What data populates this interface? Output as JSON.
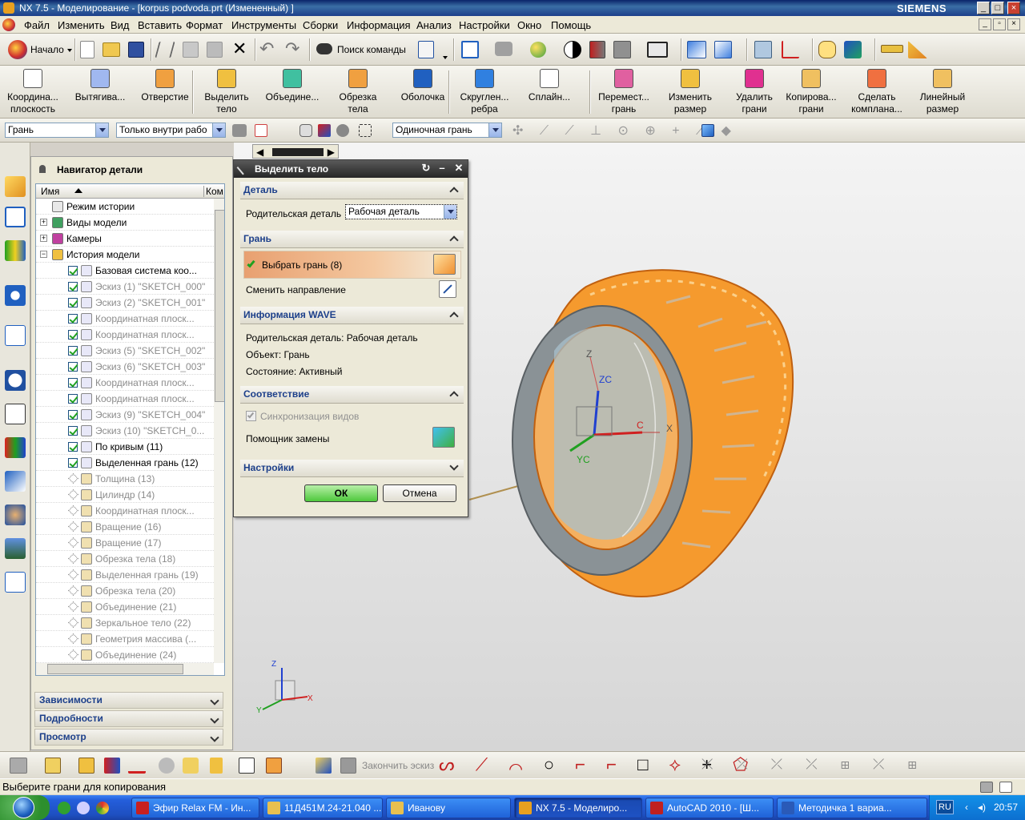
{
  "window": {
    "title": "NX 7.5 - Моделирование - [korpus podvoda.prt (Измененный) ]",
    "brand": "SIEMENS",
    "min": "_",
    "max": "□",
    "close": "×"
  },
  "menu": [
    "Файл",
    "Изменить",
    "Вид",
    "Вставить",
    "Формат",
    "Инструменты",
    "Сборки",
    "Информация",
    "Анализ",
    "Настройки",
    "Окно",
    "Помощь"
  ],
  "toolbar1": {
    "start_label": "Начало",
    "search_label": "Поиск команды"
  },
  "toolbar2": [
    {
      "label": "Координа...\nплоскость",
      "icon": "datum-plane-icon"
    },
    {
      "label": "Вытягива...",
      "icon": "extrude-icon"
    },
    {
      "label": "Отверстие",
      "icon": "hole-icon"
    },
    {
      "label": "Выделить\nтело",
      "icon": "extract-body-icon"
    },
    {
      "label": "Объедине...",
      "icon": "unite-icon"
    },
    {
      "label": "Обрезка\nтела",
      "icon": "trim-body-icon"
    },
    {
      "label": "Оболочка",
      "icon": "shell-icon"
    },
    {
      "label": "Скруглен...\nребра",
      "icon": "edge-blend-icon"
    },
    {
      "label": "Сплайн...",
      "icon": "spline-icon"
    },
    {
      "label": "Перемест...\nгрань",
      "icon": "move-face-icon"
    },
    {
      "label": "Изменить\nразмер",
      "icon": "resize-icon"
    },
    {
      "label": "Удалить\nграни",
      "icon": "delete-face-icon"
    },
    {
      "label": "Копирова...\nграни",
      "icon": "copy-face-icon"
    },
    {
      "label": "Сделать\nкомплана...",
      "icon": "make-coplanar-icon"
    },
    {
      "label": "Линейный\nразмер",
      "icon": "linear-dimension-icon"
    }
  ],
  "selection_bar": {
    "type_filter": "Грань",
    "scope": "Только внутри рабо",
    "face_rule": "Одиночная грань"
  },
  "navigator": {
    "title": "Навигатор детали",
    "col_name": "Имя",
    "col_comment": "Ком",
    "rows": [
      {
        "label": "Режим истории",
        "level": 0,
        "kind": "root"
      },
      {
        "label": "Виды модели",
        "level": 0,
        "kind": "folder"
      },
      {
        "label": "Камеры",
        "level": 0,
        "kind": "folder"
      },
      {
        "label": "История модели",
        "level": 0,
        "kind": "folder"
      },
      {
        "label": "Базовая система коо...",
        "level": 1,
        "checked": true
      },
      {
        "label": "Эскиз (1) \"SKETCH_000\"",
        "level": 1,
        "checked": true,
        "grey": true
      },
      {
        "label": "Эскиз (2) \"SKETCH_001\"",
        "level": 1,
        "checked": true,
        "grey": true
      },
      {
        "label": "Координатная плоск...",
        "level": 1,
        "checked": true,
        "grey": true
      },
      {
        "label": "Координатная плоск...",
        "level": 1,
        "checked": true,
        "grey": true
      },
      {
        "label": "Эскиз (5) \"SKETCH_002\"",
        "level": 1,
        "checked": true,
        "grey": true
      },
      {
        "label": "Эскиз (6) \"SKETCH_003\"",
        "level": 1,
        "checked": true,
        "grey": true
      },
      {
        "label": "Координатная плоск...",
        "level": 1,
        "checked": true,
        "grey": true
      },
      {
        "label": "Координатная плоск...",
        "level": 1,
        "checked": true,
        "grey": true
      },
      {
        "label": "Эскиз (9) \"SKETCH_004\"",
        "level": 1,
        "checked": true,
        "grey": true
      },
      {
        "label": "Эскиз (10) \"SKETCH_0...",
        "level": 1,
        "checked": true,
        "grey": true
      },
      {
        "label": "По кривым (11)",
        "level": 1,
        "checked": true
      },
      {
        "label": "Выделенная грань (12)",
        "level": 1,
        "checked": true
      },
      {
        "label": "Толщина (13)",
        "level": 1,
        "checked": false,
        "grey": true
      },
      {
        "label": "Цилиндр (14)",
        "level": 1,
        "checked": false,
        "grey": true
      },
      {
        "label": "Координатная плоск...",
        "level": 1,
        "checked": false,
        "grey": true
      },
      {
        "label": "Вращение (16)",
        "level": 1,
        "checked": false,
        "grey": true
      },
      {
        "label": "Вращение (17)",
        "level": 1,
        "checked": false,
        "grey": true
      },
      {
        "label": "Обрезка тела (18)",
        "level": 1,
        "checked": false,
        "grey": true
      },
      {
        "label": "Выделенная грань (19)",
        "level": 1,
        "checked": false,
        "grey": true
      },
      {
        "label": "Обрезка тела (20)",
        "level": 1,
        "checked": false,
        "grey": true
      },
      {
        "label": "Объединение (21)",
        "level": 1,
        "checked": false,
        "grey": true
      },
      {
        "label": "Зеркальное тело (22)",
        "level": 1,
        "checked": false,
        "grey": true
      },
      {
        "label": "Геометрия массива (...",
        "level": 1,
        "checked": false,
        "grey": true
      },
      {
        "label": "Объединение (24)",
        "level": 1,
        "checked": false,
        "grey": true
      }
    ],
    "sections": [
      "Зависимости",
      "Подробности",
      "Просмотр"
    ]
  },
  "dialog": {
    "title": "Выделить тело",
    "sec_part": "Деталь",
    "parent_label": "Родительская деталь",
    "parent_value": "Рабочая деталь",
    "sec_face": "Грань",
    "select_face": "Выбрать грань (8)",
    "reverse": "Сменить направление",
    "sec_wave": "Информация WAVE",
    "wave_parent": "Родительская деталь: Рабочая деталь",
    "wave_object": "Объект: Грань",
    "wave_state": "Состояние: Активный",
    "sec_assoc": "Соответствие",
    "sync_views": "Синхронизация видов",
    "replace_helper": "Помощник замены",
    "sec_settings": "Настройки",
    "ok": "ОК",
    "cancel": "Отмена"
  },
  "viewport": {
    "wcs_z": "Z",
    "wcs_zc": "ZC",
    "wcs_yc": "YC",
    "wcs_x": "X",
    "wcs_c": "C",
    "triad_z": "Z",
    "triad_x": "X",
    "triad_y": "Y",
    "model_color": "#f59a2e",
    "ring_color": "#8a9296"
  },
  "toolbar3": {
    "finish_sketch": "Закончить эскиз"
  },
  "status_text": "Выберите грани для копирования",
  "taskbar": {
    "tasks": [
      {
        "label": "Эфир Relax FM - Ин...",
        "color": "#c82020"
      },
      {
        "label": "11Д451М.24-21.040 ...",
        "color": "#e8c050"
      },
      {
        "label": "Иванову",
        "color": "#e8c050"
      },
      {
        "label": "NX 7.5 - Моделиро...",
        "color": "#e8a020",
        "active": true
      },
      {
        "label": "AutoCAD 2010 - [Ш...",
        "color": "#c02020"
      },
      {
        "label": "Методичка 1 вариа...",
        "color": "#2a5ab8"
      }
    ],
    "lang": "RU",
    "time": "20:57"
  }
}
